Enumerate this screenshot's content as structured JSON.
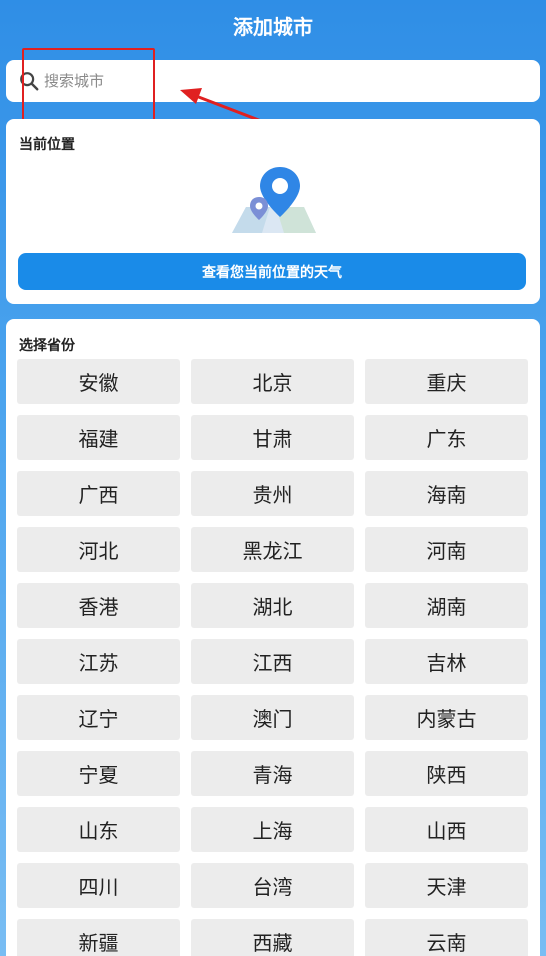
{
  "header": {
    "title": "添加城市"
  },
  "search": {
    "placeholder": "搜索城市"
  },
  "location": {
    "label": "当前位置",
    "button_label": "查看您当前位置的天气"
  },
  "provinces": {
    "label": "选择省份",
    "items": [
      "安徽",
      "北京",
      "重庆",
      "福建",
      "甘肃",
      "广东",
      "广西",
      "贵州",
      "海南",
      "河北",
      "黑龙江",
      "河南",
      "香港",
      "湖北",
      "湖南",
      "江苏",
      "江西",
      "吉林",
      "辽宁",
      "澳门",
      "内蒙古",
      "宁夏",
      "青海",
      "陕西",
      "山东",
      "上海",
      "山西",
      "四川",
      "台湾",
      "天津",
      "新疆",
      "西藏",
      "云南"
    ]
  },
  "colors": {
    "accent": "#1a8be8",
    "annotation": "#e02020",
    "button_bg": "#ececec"
  }
}
